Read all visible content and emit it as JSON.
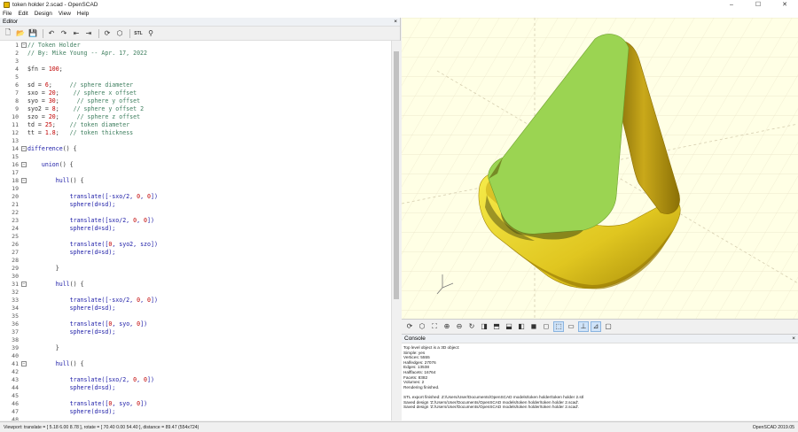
{
  "window": {
    "title": "token holder 2.scad - OpenSCAD",
    "buttons": [
      "–",
      "☐",
      "✕"
    ]
  },
  "menu": [
    "File",
    "Edit",
    "Design",
    "View",
    "Help"
  ],
  "editor": {
    "header": "Editor",
    "close": "×",
    "toolbar": [
      {
        "icon": "new-file-icon",
        "glyph": "🗋"
      },
      {
        "icon": "open-file-icon",
        "glyph": "📂"
      },
      {
        "icon": "save-icon",
        "glyph": "💾"
      },
      {
        "icon": "undo-icon",
        "glyph": "↶"
      },
      {
        "icon": "redo-icon",
        "glyph": "↷"
      },
      {
        "icon": "unindent-icon",
        "glyph": "⇤"
      },
      {
        "icon": "indent-icon",
        "glyph": "⇥"
      },
      {
        "icon": "preview-icon",
        "glyph": "⟳"
      },
      {
        "icon": "render-icon",
        "glyph": "⬡"
      },
      {
        "icon": "export-stl-icon",
        "glyph": "STL"
      },
      {
        "icon": "send-to-print-icon",
        "glyph": "⚲"
      }
    ],
    "lines": [
      [
        {
          "t": "// Token Holder",
          "c": "#3f7f5f"
        }
      ],
      [
        {
          "t": "// By: Mike Young -- Apr. 17, 2022",
          "c": "#3f7f5f"
        }
      ],
      [],
      [
        {
          "t": "$fn = ",
          "c": "#333333"
        },
        {
          "t": "100",
          "c": "#c00000"
        },
        {
          "t": ";",
          "c": "#333333"
        }
      ],
      [],
      [
        {
          "t": "sd = ",
          "c": "#333333"
        },
        {
          "t": "6",
          "c": "#c00000"
        },
        {
          "t": ";     ",
          "c": "#333333"
        },
        {
          "t": "// sphere diameter",
          "c": "#3f7f5f"
        }
      ],
      [
        {
          "t": "sxo = ",
          "c": "#333333"
        },
        {
          "t": "20",
          "c": "#c00000"
        },
        {
          "t": ";    ",
          "c": "#333333"
        },
        {
          "t": "// sphere x offset",
          "c": "#3f7f5f"
        }
      ],
      [
        {
          "t": "syo = ",
          "c": "#333333"
        },
        {
          "t": "30",
          "c": "#c00000"
        },
        {
          "t": ";     ",
          "c": "#333333"
        },
        {
          "t": "// sphere y offset",
          "c": "#3f7f5f"
        }
      ],
      [
        {
          "t": "syo2 = ",
          "c": "#333333"
        },
        {
          "t": "8",
          "c": "#c00000"
        },
        {
          "t": ";    ",
          "c": "#333333"
        },
        {
          "t": "// sphere y offset 2",
          "c": "#3f7f5f"
        }
      ],
      [
        {
          "t": "szo = ",
          "c": "#333333"
        },
        {
          "t": "20",
          "c": "#c00000"
        },
        {
          "t": ";     ",
          "c": "#333333"
        },
        {
          "t": "// sphere z offset",
          "c": "#3f7f5f"
        }
      ],
      [
        {
          "t": "td = ",
          "c": "#333333"
        },
        {
          "t": "25",
          "c": "#c00000"
        },
        {
          "t": ";    ",
          "c": "#333333"
        },
        {
          "t": "// token diameter",
          "c": "#3f7f5f"
        }
      ],
      [
        {
          "t": "tt = ",
          "c": "#333333"
        },
        {
          "t": "1.8",
          "c": "#c00000"
        },
        {
          "t": ";   ",
          "c": "#333333"
        },
        {
          "t": "// token thickness",
          "c": "#3f7f5f"
        }
      ],
      [],
      [
        {
          "t": "difference",
          "c": "#1a1aa6"
        },
        {
          "t": "() {",
          "c": "#333333"
        }
      ],
      [],
      [
        {
          "t": "    ",
          "c": "#333333"
        },
        {
          "t": "union",
          "c": "#1a1aa6"
        },
        {
          "t": "() {",
          "c": "#333333"
        }
      ],
      [],
      [
        {
          "t": "        ",
          "c": "#333333"
        },
        {
          "t": "hull",
          "c": "#1a1aa6"
        },
        {
          "t": "() {",
          "c": "#333333"
        }
      ],
      [],
      [
        {
          "t": "            ",
          "c": "#333333"
        },
        {
          "t": "translate",
          "c": "#1a1aa6"
        },
        {
          "t": "([-sxo/2, ",
          "c": "#1a1aa6"
        },
        {
          "t": "0",
          "c": "#c00000"
        },
        {
          "t": ", ",
          "c": "#1a1aa6"
        },
        {
          "t": "0",
          "c": "#c00000"
        },
        {
          "t": "])",
          "c": "#1a1aa6"
        }
      ],
      [
        {
          "t": "            ",
          "c": "#333333"
        },
        {
          "t": "sphere",
          "c": "#1a1aa6"
        },
        {
          "t": "(d=sd);",
          "c": "#1a1aa6"
        }
      ],
      [],
      [
        {
          "t": "            ",
          "c": "#333333"
        },
        {
          "t": "translate",
          "c": "#1a1aa6"
        },
        {
          "t": "([sxo/2, ",
          "c": "#1a1aa6"
        },
        {
          "t": "0",
          "c": "#c00000"
        },
        {
          "t": ", ",
          "c": "#1a1aa6"
        },
        {
          "t": "0",
          "c": "#c00000"
        },
        {
          "t": "])",
          "c": "#1a1aa6"
        }
      ],
      [
        {
          "t": "            ",
          "c": "#333333"
        },
        {
          "t": "sphere",
          "c": "#1a1aa6"
        },
        {
          "t": "(d=sd);",
          "c": "#1a1aa6"
        }
      ],
      [],
      [
        {
          "t": "            ",
          "c": "#333333"
        },
        {
          "t": "translate",
          "c": "#1a1aa6"
        },
        {
          "t": "([",
          "c": "#1a1aa6"
        },
        {
          "t": "0",
          "c": "#c00000"
        },
        {
          "t": ", syo2, szo])",
          "c": "#1a1aa6"
        }
      ],
      [
        {
          "t": "            ",
          "c": "#333333"
        },
        {
          "t": "sphere",
          "c": "#1a1aa6"
        },
        {
          "t": "(d=sd);",
          "c": "#1a1aa6"
        }
      ],
      [],
      [
        {
          "t": "        }",
          "c": "#333333"
        }
      ],
      [],
      [
        {
          "t": "        ",
          "c": "#333333"
        },
        {
          "t": "hull",
          "c": "#1a1aa6"
        },
        {
          "t": "() {",
          "c": "#333333"
        }
      ],
      [],
      [
        {
          "t": "            ",
          "c": "#333333"
        },
        {
          "t": "translate",
          "c": "#1a1aa6"
        },
        {
          "t": "([-sxo/2, ",
          "c": "#1a1aa6"
        },
        {
          "t": "0",
          "c": "#c00000"
        },
        {
          "t": ", ",
          "c": "#1a1aa6"
        },
        {
          "t": "0",
          "c": "#c00000"
        },
        {
          "t": "])",
          "c": "#1a1aa6"
        }
      ],
      [
        {
          "t": "            ",
          "c": "#333333"
        },
        {
          "t": "sphere",
          "c": "#1a1aa6"
        },
        {
          "t": "(d=sd);",
          "c": "#1a1aa6"
        }
      ],
      [],
      [
        {
          "t": "            ",
          "c": "#333333"
        },
        {
          "t": "translate",
          "c": "#1a1aa6"
        },
        {
          "t": "([",
          "c": "#1a1aa6"
        },
        {
          "t": "0",
          "c": "#c00000"
        },
        {
          "t": ", syo, ",
          "c": "#1a1aa6"
        },
        {
          "t": "0",
          "c": "#c00000"
        },
        {
          "t": "])",
          "c": "#1a1aa6"
        }
      ],
      [
        {
          "t": "            ",
          "c": "#333333"
        },
        {
          "t": "sphere",
          "c": "#1a1aa6"
        },
        {
          "t": "(d=sd);",
          "c": "#1a1aa6"
        }
      ],
      [],
      [
        {
          "t": "        }",
          "c": "#333333"
        }
      ],
      [],
      [
        {
          "t": "        ",
          "c": "#333333"
        },
        {
          "t": "hull",
          "c": "#1a1aa6"
        },
        {
          "t": "() {",
          "c": "#333333"
        }
      ],
      [],
      [
        {
          "t": "            ",
          "c": "#333333"
        },
        {
          "t": "translate",
          "c": "#1a1aa6"
        },
        {
          "t": "([sxo/2, ",
          "c": "#1a1aa6"
        },
        {
          "t": "0",
          "c": "#c00000"
        },
        {
          "t": ", ",
          "c": "#1a1aa6"
        },
        {
          "t": "0",
          "c": "#c00000"
        },
        {
          "t": "])",
          "c": "#1a1aa6"
        }
      ],
      [
        {
          "t": "            ",
          "c": "#333333"
        },
        {
          "t": "sphere",
          "c": "#1a1aa6"
        },
        {
          "t": "(d=sd);",
          "c": "#1a1aa6"
        }
      ],
      [],
      [
        {
          "t": "            ",
          "c": "#333333"
        },
        {
          "t": "translate",
          "c": "#1a1aa6"
        },
        {
          "t": "([",
          "c": "#1a1aa6"
        },
        {
          "t": "0",
          "c": "#c00000"
        },
        {
          "t": ", syo, ",
          "c": "#1a1aa6"
        },
        {
          "t": "0",
          "c": "#c00000"
        },
        {
          "t": "])",
          "c": "#1a1aa6"
        }
      ],
      [
        {
          "t": "            ",
          "c": "#333333"
        },
        {
          "t": "sphere",
          "c": "#1a1aa6"
        },
        {
          "t": "(d=sd);",
          "c": "#1a1aa6"
        }
      ],
      []
    ],
    "fold_lines": [
      1,
      14,
      16,
      18,
      31,
      41
    ]
  },
  "viewport_toolbar": [
    {
      "icon": "preview-icon",
      "glyph": "⟳",
      "on": false
    },
    {
      "icon": "render-icon",
      "glyph": "⬡",
      "on": false
    },
    {
      "icon": "view-all-icon",
      "glyph": "⛶",
      "on": false
    },
    {
      "icon": "zoom-in-icon",
      "glyph": "⊕",
      "on": false
    },
    {
      "icon": "zoom-out-icon",
      "glyph": "⊖",
      "on": false
    },
    {
      "icon": "reset-view-icon",
      "glyph": "↻",
      "on": false
    },
    {
      "icon": "view-right-icon",
      "glyph": "◨",
      "on": false
    },
    {
      "icon": "view-top-icon",
      "glyph": "⬒",
      "on": false
    },
    {
      "icon": "view-bottom-icon",
      "glyph": "⬓",
      "on": false
    },
    {
      "icon": "view-left-icon",
      "glyph": "◧",
      "on": false
    },
    {
      "icon": "view-front-icon",
      "glyph": "◼",
      "on": false
    },
    {
      "icon": "view-back-icon",
      "glyph": "◻",
      "on": false
    },
    {
      "icon": "perspective-icon",
      "glyph": "⬚",
      "on": true
    },
    {
      "icon": "orthogonal-icon",
      "glyph": "▭",
      "on": false
    },
    {
      "icon": "show-axes-icon",
      "glyph": "⊥",
      "on": true
    },
    {
      "icon": "show-scale-icon",
      "glyph": "⊿",
      "on": true
    },
    {
      "icon": "show-edges-icon",
      "glyph": "▢",
      "on": false
    }
  ],
  "console": {
    "header": "Console",
    "close": "×",
    "lines": [
      "Top level object is a 3D object:",
      "Simple:  yes",
      "Vertices:  5555",
      "Halfedges:  27076",
      "Edges:  13538",
      "Halffacets:  16764",
      "Facets:  8382",
      "Volumes:  2",
      "Rendering finished.",
      "",
      "STL export finished: Z:/Users/User/Documents/OpenSCAD models/token holder/token holder 2.stl",
      "Saved design 'Z:/Users/User/Documents/OpenSCAD models/token holder/token holder 2.scad'.",
      "Saved design 'Z:/Users/User/Documents/OpenSCAD models/token holder/token holder 2.scad'."
    ]
  },
  "status": {
    "viewport": "Viewport: translate = [ 5.18 6.00 8.78 ], rotate = [ 70.40 0.00 54.40 ], distance = 89.47 (554x724)",
    "version": "OpenSCAD 2019.05"
  },
  "colors": {
    "model_yellow": "#f2e63a",
    "cut_face_green": "#9bd452",
    "viewport_bg": "#ffffe5"
  }
}
